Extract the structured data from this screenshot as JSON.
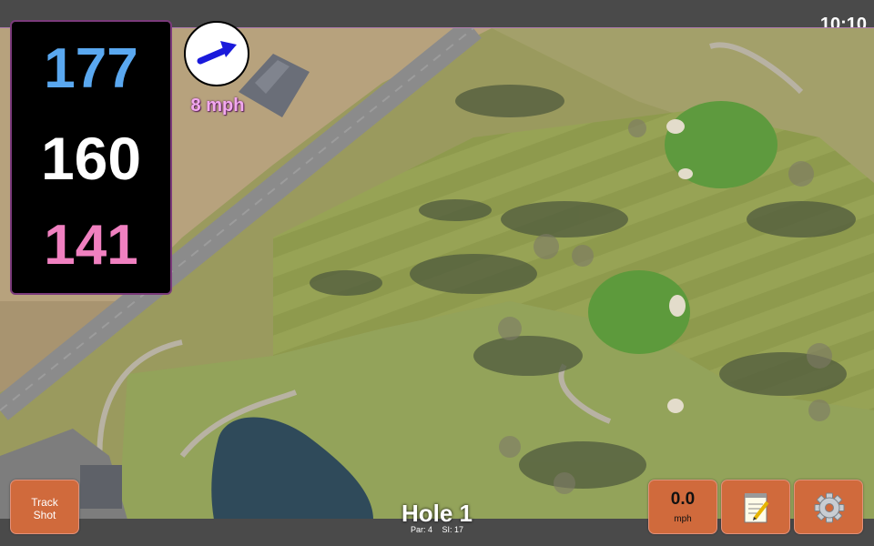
{
  "status": {
    "time": "10:10"
  },
  "distances": {
    "back": "177",
    "middle": "160",
    "front": "141"
  },
  "wind": {
    "speed_label": "8 mph",
    "icon": "wind-arrow-icon",
    "direction": "east-northeast"
  },
  "hole": {
    "title": "Hole 1",
    "par_label": "Par: 4",
    "si_label": "SI: 17"
  },
  "buttons": {
    "track_shot_line1": "Track",
    "track_shot_line2": "Shot",
    "speed_value": "0.0",
    "speed_unit": "mph",
    "notes_icon": "notepad-icon",
    "settings_icon": "gear-icon"
  },
  "colors": {
    "back_distance": "#5aa8f0",
    "middle_distance": "#ffffff",
    "front_distance": "#f080c0",
    "button": "#d06a3c",
    "wind_label": "#f2a8ef"
  }
}
